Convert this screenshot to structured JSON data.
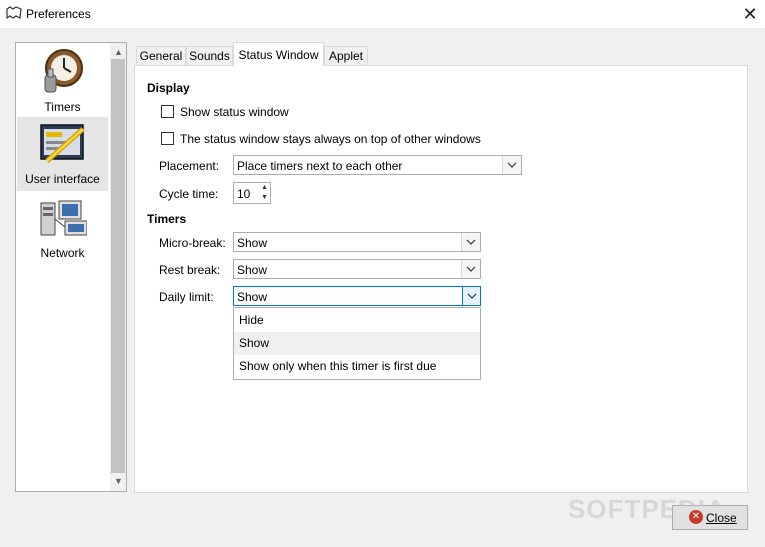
{
  "window": {
    "title": "Preferences",
    "close_glyph": "✕"
  },
  "sidebar": {
    "items": [
      {
        "label": "Timers",
        "icon": "clock-icon",
        "selected": false
      },
      {
        "label": "User interface",
        "icon": "user-interface-icon",
        "selected": true
      },
      {
        "label": "Network",
        "icon": "network-icon",
        "selected": false
      }
    ]
  },
  "tabs": [
    {
      "label": "General",
      "active": false
    },
    {
      "label": "Sounds",
      "active": false
    },
    {
      "label": "Status Window",
      "active": true
    },
    {
      "label": "Applet",
      "active": false
    }
  ],
  "display": {
    "heading": "Display",
    "show_status_window": {
      "label": "Show status window",
      "checked": false
    },
    "always_on_top": {
      "label": "The status window stays always on top of other windows",
      "checked": false
    },
    "placement": {
      "label": "Placement:",
      "value": "Place timers next to each other"
    },
    "cycle_time": {
      "label": "Cycle time:",
      "value": "10"
    }
  },
  "timers": {
    "heading": "Timers",
    "micro_break": {
      "label": "Micro-break:",
      "value": "Show"
    },
    "rest_break": {
      "label": "Rest break:",
      "value": "Show"
    },
    "daily_limit": {
      "label": "Daily limit:",
      "value": "Show",
      "options": [
        "Hide",
        "Show",
        "Show only when this timer is first due"
      ],
      "highlighted_option": "Show"
    }
  },
  "footer": {
    "close_label": "Close"
  },
  "watermark": "SOFTPEDIA",
  "colors": {
    "accent": "#0078d7",
    "close_icon": "#c53929"
  }
}
